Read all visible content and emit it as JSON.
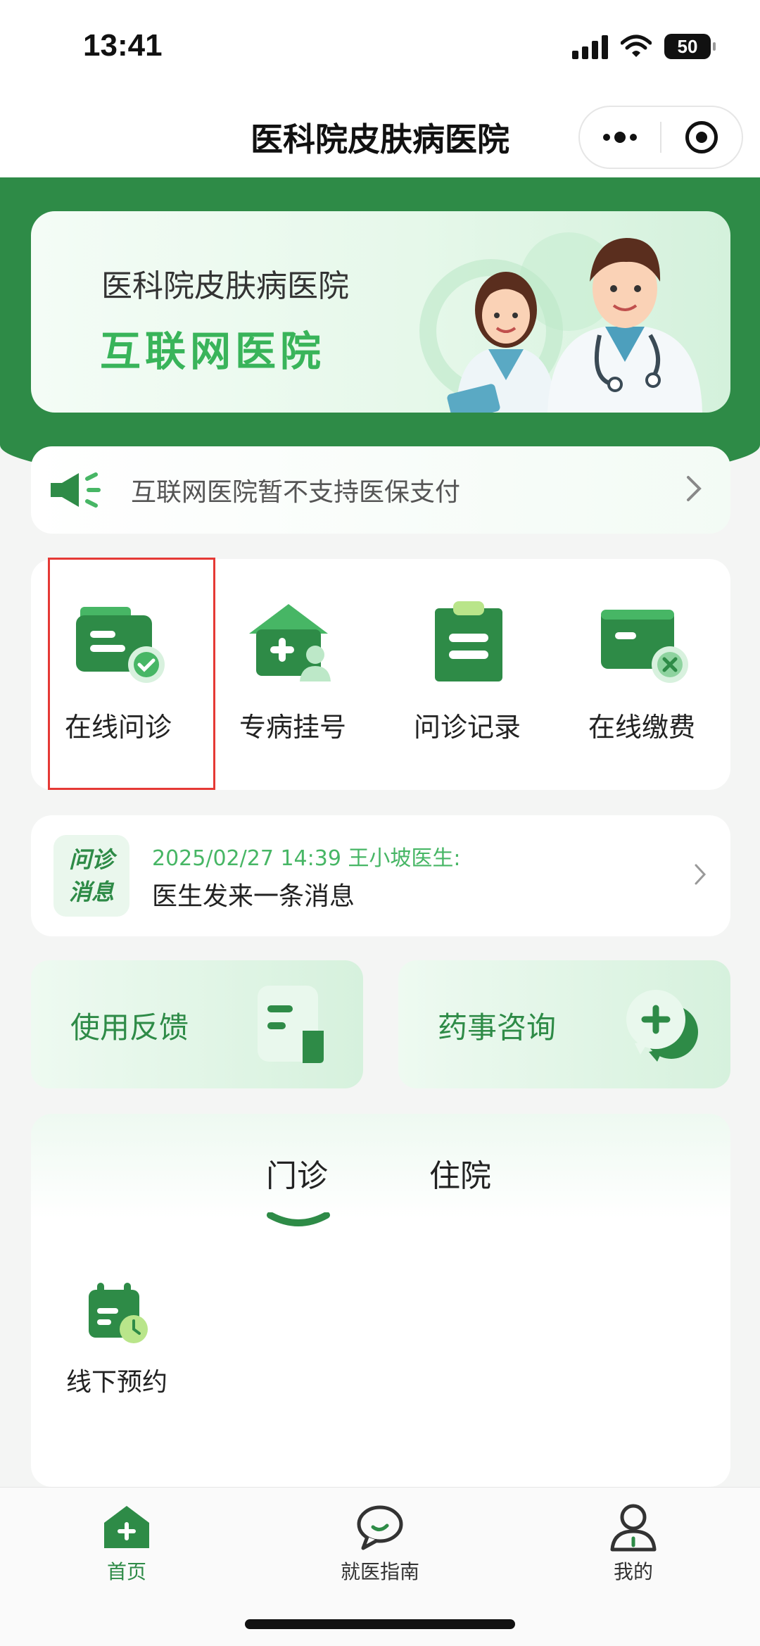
{
  "status_bar": {
    "time": "13:41",
    "battery": "50"
  },
  "nav": {
    "title": "医科院皮肤病医院"
  },
  "banner": {
    "title": "医科院皮肤病医院",
    "subtitle": "互联网医院"
  },
  "notice": {
    "text": "互联网医院暂不支持医保支付"
  },
  "services": [
    {
      "label": "在线问诊",
      "icon": "consult-folder-check-icon"
    },
    {
      "label": "专病挂号",
      "icon": "register-house-plus-icon"
    },
    {
      "label": "问诊记录",
      "icon": "record-clipboard-icon"
    },
    {
      "label": "在线缴费",
      "icon": "payment-wallet-icon"
    }
  ],
  "message": {
    "badge_line1": "问诊",
    "badge_line2": "消息",
    "meta": "2025/02/27 14:39 王小坡医生:",
    "text": "医生发来一条消息"
  },
  "quick_links": [
    {
      "label": "使用反馈",
      "icon": "feedback-document-icon"
    },
    {
      "label": "药事咨询",
      "icon": "pharmacy-chat-plus-icon"
    }
  ],
  "care_tabs": {
    "tabs": [
      "门诊",
      "住院"
    ],
    "active": "门诊",
    "items": [
      {
        "label": "线下预约",
        "icon": "calendar-clock-icon"
      }
    ]
  },
  "tab_bar": {
    "items": [
      {
        "label": "首页",
        "icon": "home-icon",
        "active": true
      },
      {
        "label": "就医指南",
        "icon": "guide-chat-icon",
        "active": false
      },
      {
        "label": "我的",
        "icon": "profile-person-icon",
        "active": false
      }
    ]
  },
  "colors": {
    "brand_green": "#2e8b47",
    "light_green": "#47b665",
    "highlight_red": "#e53935"
  }
}
